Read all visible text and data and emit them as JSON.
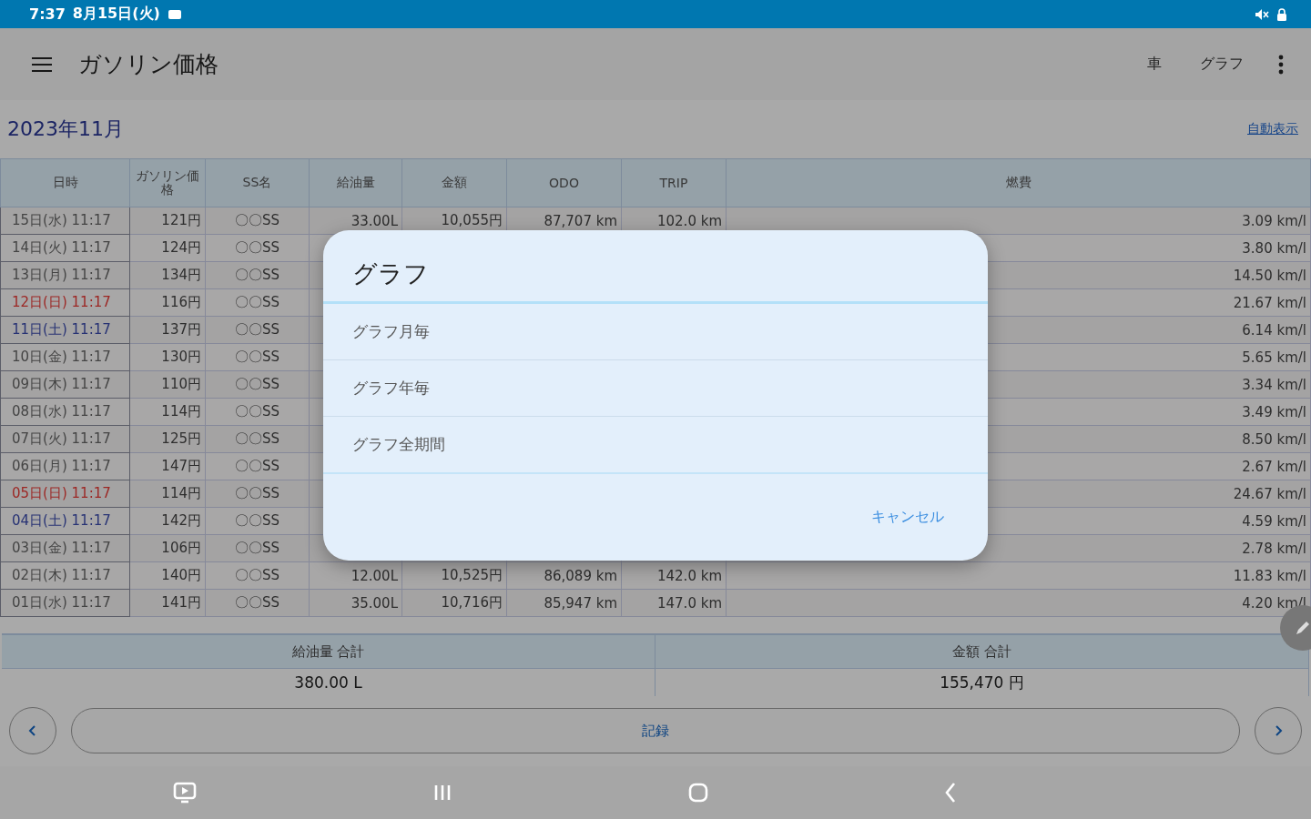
{
  "status_bar": {
    "time": "7:37",
    "date": "8月15日(火)"
  },
  "app_bar": {
    "title": "ガソリン価格",
    "actions": [
      "車",
      "グラフ"
    ]
  },
  "month": {
    "title": "2023年11月",
    "link": "自動表示"
  },
  "table": {
    "columns": [
      "日時",
      "ガソリン価格",
      "SS名",
      "給油量",
      "金額",
      "ODO",
      "TRIP",
      "燃費"
    ],
    "rows": [
      {
        "date": "15日(水) 11:17",
        "color": "#444444",
        "price": "121円",
        "station": "〇〇SS",
        "amount": "33.00L",
        "cost": "10,055円",
        "odo": "87,707 km",
        "trip": "102.0 km",
        "mileage": "3.09 km/l"
      },
      {
        "date": "14日(火) 11:17",
        "color": "#444444",
        "price": "124円",
        "station": "〇〇SS",
        "mileage": "3.80 km/l"
      },
      {
        "date": "13日(月) 11:17",
        "color": "#444444",
        "price": "134円",
        "station": "〇〇SS",
        "mileage": "14.50 km/l"
      },
      {
        "date": "12日(日) 11:17",
        "color": "#9c2724",
        "price": "116円",
        "station": "〇〇SS",
        "mileage": "21.67 km/l"
      },
      {
        "date": "11日(土) 11:17",
        "color": "#273274",
        "price": "137円",
        "station": "〇〇SS",
        "mileage": "6.14 km/l"
      },
      {
        "date": "10日(金) 11:17",
        "color": "#444444",
        "price": "130円",
        "station": "〇〇SS",
        "mileage": "5.65 km/l"
      },
      {
        "date": "09日(木) 11:17",
        "color": "#444444",
        "price": "110円",
        "station": "〇〇SS",
        "mileage": "3.34 km/l"
      },
      {
        "date": "08日(水) 11:17",
        "color": "#444444",
        "price": "114円",
        "station": "〇〇SS",
        "mileage": "3.49 km/l"
      },
      {
        "date": "07日(火) 11:17",
        "color": "#444444",
        "price": "125円",
        "station": "〇〇SS",
        "mileage": "8.50 km/l"
      },
      {
        "date": "06日(月) 11:17",
        "color": "#444444",
        "price": "147円",
        "station": "〇〇SS",
        "mileage": "2.67 km/l"
      },
      {
        "date": "05日(日) 11:17",
        "color": "#9c2724",
        "price": "114円",
        "station": "〇〇SS",
        "mileage": "24.67 km/l"
      },
      {
        "date": "04日(土) 11:17",
        "color": "#273274",
        "price": "142円",
        "station": "〇〇SS",
        "mileage": "4.59 km/l"
      },
      {
        "date": "03日(金) 11:17",
        "color": "#444444",
        "price": "106円",
        "station": "〇〇SS",
        "mileage": "2.78 km/l"
      },
      {
        "date": "02日(木) 11:17",
        "color": "#444444",
        "price": "140円",
        "station": "〇〇SS",
        "amount": "12.00L",
        "cost": "10,525円",
        "odo": "86,089 km",
        "trip": "142.0 km",
        "mileage": "11.83 km/l"
      },
      {
        "date": "01日(水) 11:17",
        "color": "#444444",
        "price": "141円",
        "station": "〇〇SS",
        "amount": "35.00L",
        "cost": "10,716円",
        "odo": "85,947 km",
        "trip": "147.0 km",
        "mileage": "4.20 km/l"
      }
    ]
  },
  "totals": [
    {
      "label": "給油量 合計",
      "value": "380.00 L"
    },
    {
      "label": "金額 合計",
      "value": "155,470 円"
    }
  ],
  "record_button": "記録",
  "dialog": {
    "title": "グラフ",
    "items": [
      "グラフ月毎",
      "グラフ年毎",
      "グラフ全期間"
    ],
    "cancel": "キャンセル"
  }
}
